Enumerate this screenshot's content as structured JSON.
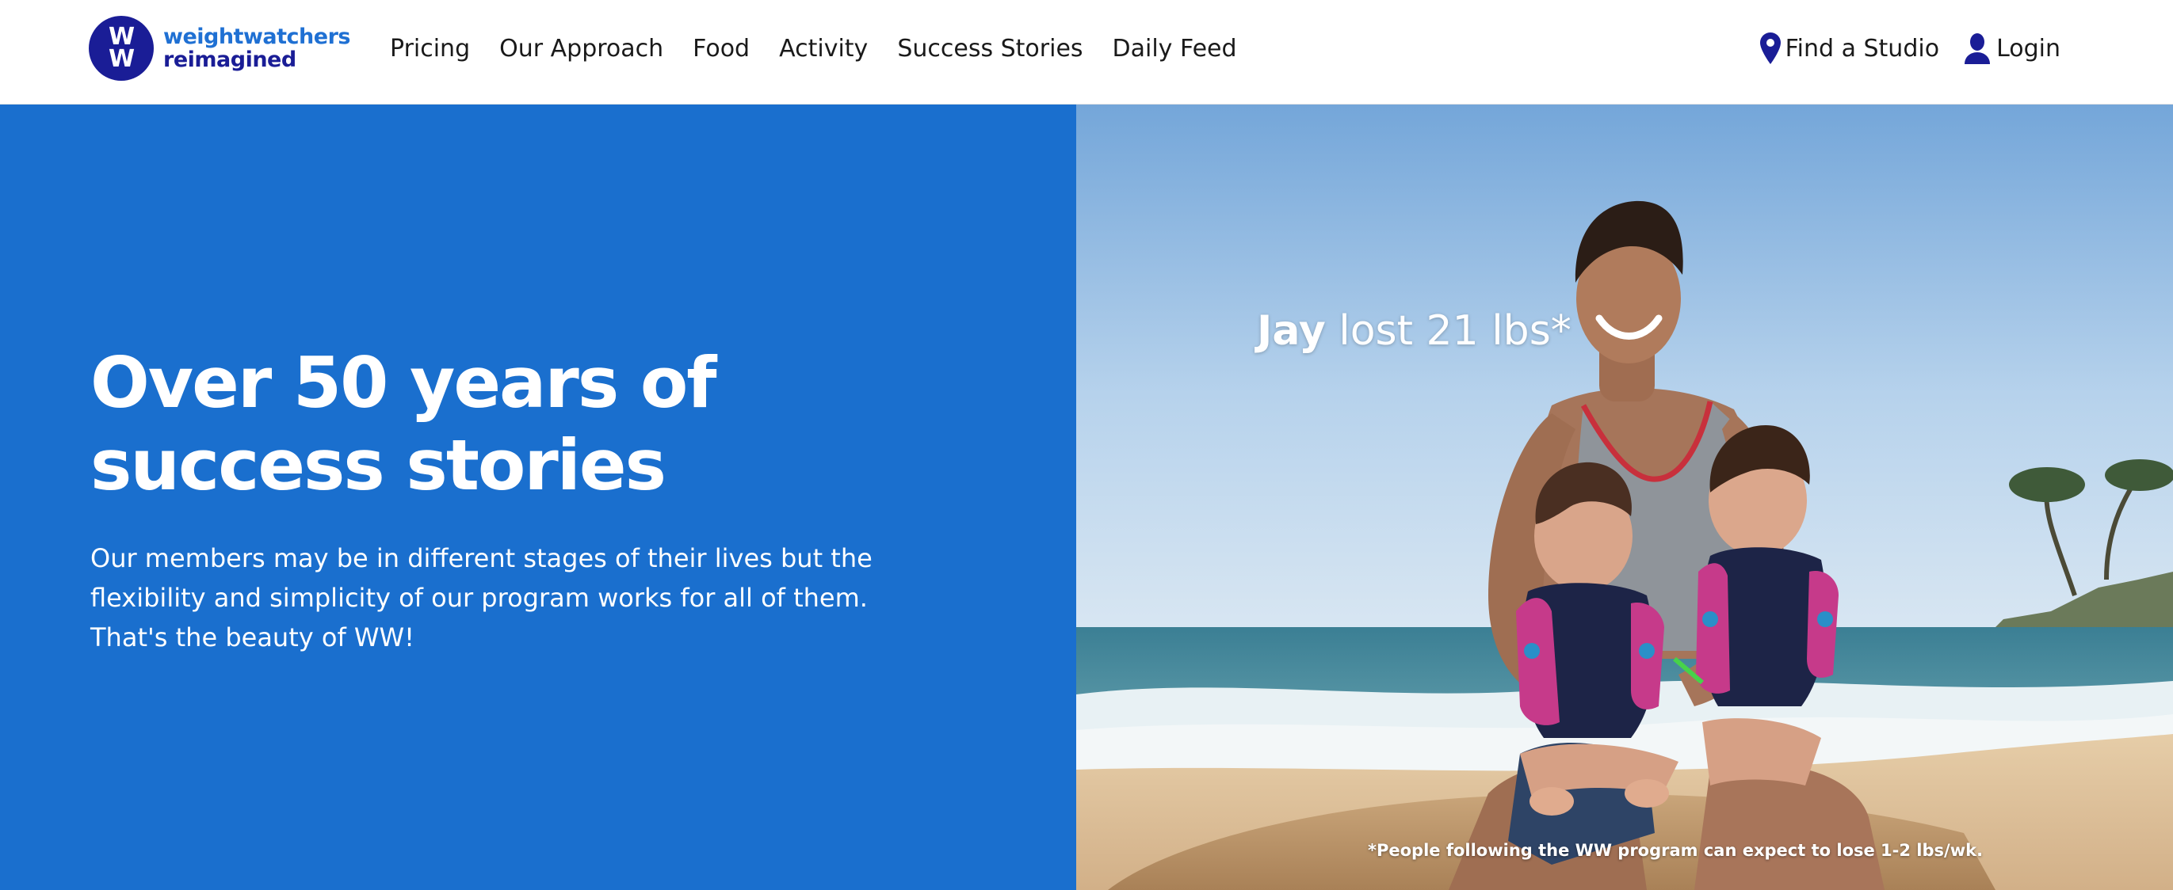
{
  "header": {
    "logo": {
      "mark_line1": "W",
      "mark_line2": "W",
      "line1": "weightwatchers",
      "line2": "reimagined"
    },
    "nav": [
      {
        "label": "Pricing"
      },
      {
        "label": "Our Approach"
      },
      {
        "label": "Food"
      },
      {
        "label": "Activity"
      },
      {
        "label": "Success Stories"
      },
      {
        "label": "Daily Feed"
      }
    ],
    "find_studio": {
      "label": "Find a Studio",
      "icon": "map-pin-icon"
    },
    "login": {
      "label": "Login",
      "icon": "user-icon"
    }
  },
  "hero": {
    "title_line1": "Over 50 years of",
    "title_line2": "success stories",
    "body_line1": "Our members may be in different stages of their lives but the",
    "body_line2": "flexibility and simplicity of our program works for all of them.",
    "body_line3": "That's the beauty of WW!",
    "caption_name": "Jay",
    "caption_rest": " lost 21 lbs*",
    "disclaimer": "*People following the WW program can expect to lose 1-2 lbs/wk."
  },
  "colors": {
    "brand_navy": "#1a1d96",
    "brand_blue": "#1f70d3",
    "hero_blue": "#1a6fce"
  }
}
